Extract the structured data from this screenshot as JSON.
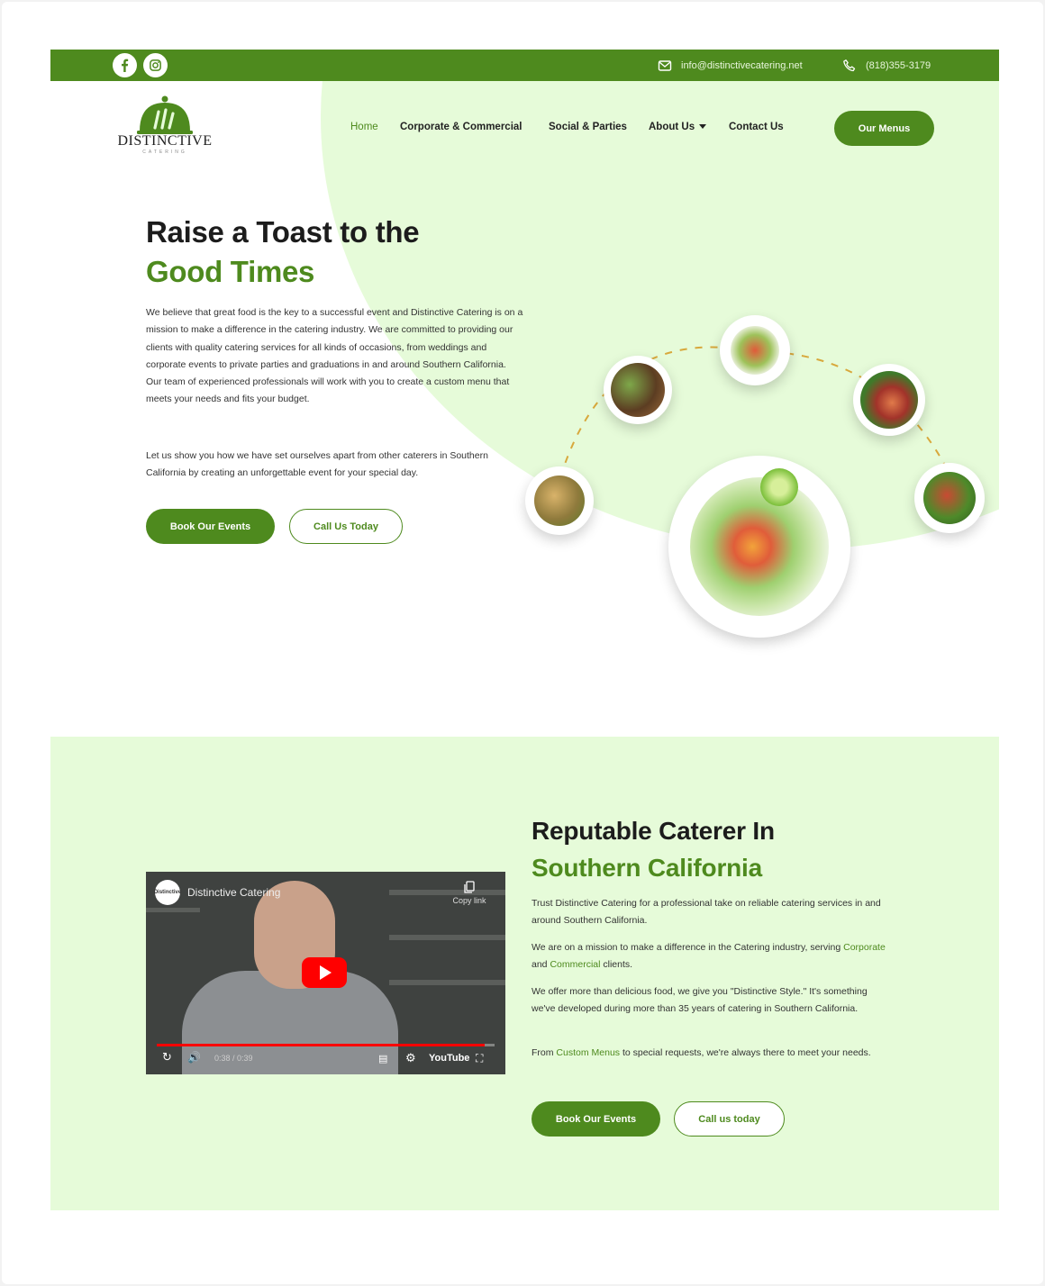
{
  "topbar": {
    "email": "info@distinctivecatering.net",
    "phone": "(818)355-3179"
  },
  "brand": {
    "name": "DISTINCTIVE",
    "tagline": "CATERING"
  },
  "nav": {
    "items": [
      {
        "label": "Home",
        "active": true
      },
      {
        "label": "Corporate & Commercial"
      },
      {
        "label": "Social & Parties"
      },
      {
        "label": "About Us"
      },
      {
        "label": "Contact Us"
      }
    ],
    "cta": "Our Menus"
  },
  "hero": {
    "title_line1": "Raise a Toast to the",
    "title_line2": "Good Times",
    "paragraph1": "We believe that great food is the key to a successful event and Distinctive Catering is on a mission to make a difference in the catering industry. We are committed to providing our clients with quality catering services for all kinds of occasions, from weddings and corporate events to private parties and graduations in and around Southern California. Our team of experienced professionals will work with you to create a custom menu that meets your needs and fits your budget.",
    "paragraph2": "Let us show you how we have set ourselves apart from other caterers in Southern California by creating an unforgettable event for your special day.",
    "btn_primary": "Book Our Events",
    "btn_secondary": "Call Us Today"
  },
  "section2": {
    "title_line1": "Reputable Caterer In",
    "title_line2": "Southern California",
    "p1": "Trust Distinctive Catering for a professional take on reliable catering services in and around Southern California.",
    "p2_start": "We are on a mission to make a difference in the Catering industry, serving",
    "p2_link1": "Corporate",
    "p2_and": "and",
    "p2_link2": "Commercial",
    "p2_end": "clients.",
    "p3": "We offer more than delicious food, we give you \"Distinctive Style.\" It's something we've developed during more than 35 years of catering in Southern California.",
    "p4_start": "From",
    "p4_link": "Custom Menus",
    "p4_end": "to special requests, we're always there to meet your needs.",
    "btn_primary": "Book Our Events",
    "btn_secondary": "Call us today"
  },
  "video": {
    "channel_badge": "Distinctive",
    "title": "Distinctive Catering",
    "copy_link": "Copy link",
    "time": "0:38 / 0:39",
    "progress": 0.97,
    "platform": "YouTube"
  },
  "colors": {
    "brand_green": "#4e8a1e",
    "light_green": "#e6fbd9"
  },
  "icons": [
    "facebook-icon",
    "instagram-icon",
    "mail-icon",
    "phone-icon",
    "play-icon",
    "copy-icon",
    "replay-icon",
    "volume-icon",
    "captions-icon",
    "settings-icon",
    "fullscreen-icon"
  ]
}
